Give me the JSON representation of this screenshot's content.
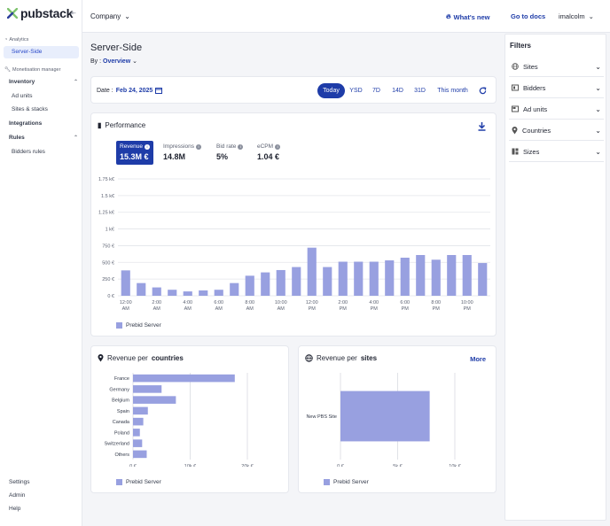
{
  "app": {
    "brand": "pubstack"
  },
  "sidebar": {
    "analytics_title": "Analytics",
    "analytics_items": [
      {
        "label": "Server-Side",
        "active": true
      }
    ],
    "monetisation_title": "Monetisation manager",
    "inventory": {
      "label": "Inventory",
      "items": [
        "Ad units",
        "Sites & stacks"
      ]
    },
    "integrations": "Integrations",
    "rules": {
      "label": "Rules",
      "items": [
        "Bidders rules"
      ]
    },
    "bottom": [
      "Settings",
      "Admin",
      "Help"
    ]
  },
  "topbar": {
    "company": "Company",
    "whats_new": "What's new",
    "docs": "Go to docs",
    "user": "imalcolm"
  },
  "page": {
    "title": "Server-Side",
    "by_label": "By :",
    "by_value": "Overview"
  },
  "datebar": {
    "date_label": "Date :",
    "date_value": "Feb 24, 2025",
    "ranges": [
      {
        "label": "Today",
        "active": true
      },
      {
        "label": "YSD",
        "active": false
      },
      {
        "label": "7D",
        "active": false
      },
      {
        "label": "14D",
        "active": false
      },
      {
        "label": "31D",
        "active": false
      },
      {
        "label": "This month",
        "active": false
      }
    ]
  },
  "performance": {
    "title": "Performance",
    "metrics": [
      {
        "label": "Revenue",
        "value": "15.3M €",
        "active": true
      },
      {
        "label": "Impressions",
        "value": "14.8M",
        "active": false
      },
      {
        "label": "Bid rate",
        "value": "5%",
        "active": false
      },
      {
        "label": "eCPM",
        "value": "1.04 €",
        "active": false
      }
    ]
  },
  "colors": {
    "accent": "#1e3ca8",
    "bar": "#98a0e0"
  },
  "chart_data": [
    {
      "type": "bar",
      "categories": [
        "12:00 AM",
        "1:00 AM",
        "2:00 AM",
        "3:00 AM",
        "4:00 AM",
        "5:00 AM",
        "6:00 AM",
        "7:00 AM",
        "8:00 AM",
        "9:00 AM",
        "10:00 AM",
        "11:00 AM",
        "12:00 PM",
        "1:00 PM",
        "2:00 PM",
        "3:00 PM",
        "4:00 PM",
        "5:00 PM",
        "6:00 PM",
        "7:00 PM",
        "8:00 PM",
        "9:00 PM",
        "10:00 PM",
        "11:00 PM"
      ],
      "tick_labels": [
        "12:00 AM",
        "2:00 AM",
        "4:00 AM",
        "6:00 AM",
        "8:00 AM",
        "10:00 AM",
        "12:00 PM",
        "2:00 PM",
        "4:00 PM",
        "6:00 PM",
        "8:00 PM",
        "10:00 PM"
      ],
      "series": [
        {
          "name": "Prebid Server",
          "values": [
            380,
            190,
            125,
            90,
            65,
            80,
            90,
            190,
            300,
            350,
            385,
            430,
            720,
            430,
            510,
            510,
            510,
            530,
            570,
            610,
            540,
            610,
            610,
            490
          ]
        }
      ],
      "yticks": [
        "0 €",
        "250 €",
        "500 €",
        "750 €",
        "1 k€",
        "1.25 k€",
        "1.5 k€",
        "1.75 k€"
      ],
      "ylim": [
        0,
        1750
      ],
      "grid": true,
      "legend": "bottom-left"
    },
    {
      "type": "bar",
      "orientation": "horizontal",
      "title": "Revenue per countries",
      "title_prefix": "Revenue per",
      "title_bold": "countries",
      "categories": [
        "France",
        "Germany",
        "Belgium",
        "Spain",
        "Canada",
        "Poland",
        "Switzerland",
        "Others"
      ],
      "series": [
        {
          "name": "Prebid Server",
          "values": [
            17800,
            5000,
            7500,
            2600,
            1800,
            1200,
            1600,
            2400
          ]
        }
      ],
      "xticks": [
        "0 €",
        "10k €",
        "20k €"
      ],
      "xlim": [
        0,
        20000
      ],
      "grid": true,
      "legend": "bottom-left"
    },
    {
      "type": "bar",
      "orientation": "horizontal",
      "title": "Revenue per sites",
      "title_prefix": "Revenue per",
      "title_bold": "sites",
      "more_label": "More",
      "categories": [
        "New PBS Site"
      ],
      "series": [
        {
          "name": "Prebid Server",
          "values": [
            7800
          ]
        }
      ],
      "xticks": [
        "0 €",
        "5k €",
        "10k €"
      ],
      "xlim": [
        0,
        10000
      ],
      "grid": true,
      "legend": "bottom-left"
    }
  ],
  "filters": {
    "title": "Filters",
    "items": [
      {
        "label": "Sites",
        "icon": "globe-icon"
      },
      {
        "label": "Bidders",
        "icon": "bidders-icon"
      },
      {
        "label": "Ad units",
        "icon": "ad-unit-icon"
      },
      {
        "label": "Countries",
        "icon": "pin-icon"
      },
      {
        "label": "Sizes",
        "icon": "sizes-icon"
      }
    ]
  }
}
